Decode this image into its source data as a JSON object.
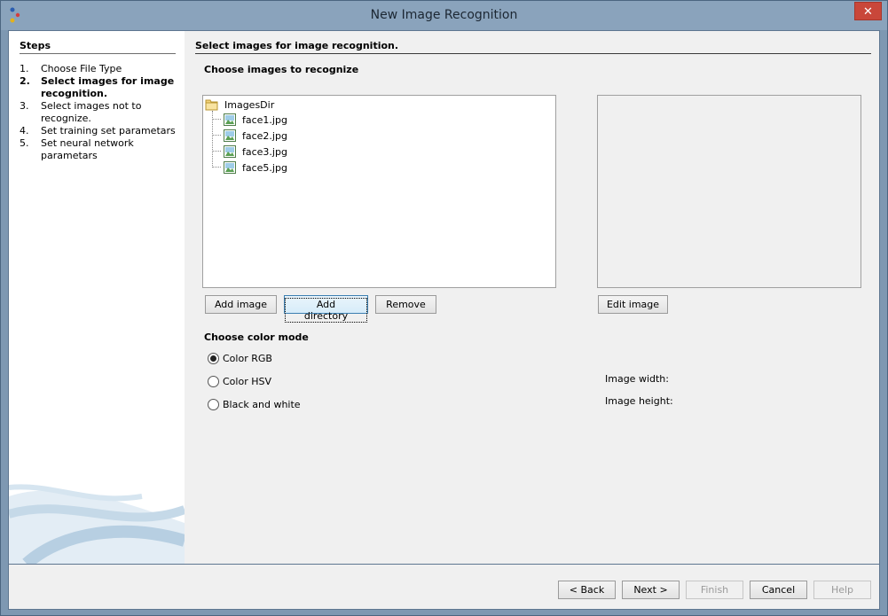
{
  "window": {
    "title": "New Image Recognition",
    "close_glyph": "✕"
  },
  "steps": {
    "title": "Steps",
    "items": [
      {
        "num": "1.",
        "label": "Choose File Type",
        "active": false
      },
      {
        "num": "2.",
        "label": "Select images for image recognition.",
        "active": true
      },
      {
        "num": "3.",
        "label": "Select images not to recognize.",
        "active": false
      },
      {
        "num": "4.",
        "label": "Set training set parametars",
        "active": false
      },
      {
        "num": "5.",
        "label": "Set neural network parametars",
        "active": false
      }
    ]
  },
  "main": {
    "header": "Select images for image recognition.",
    "choose_images_label": "Choose images to recognize",
    "tree": {
      "root": "ImagesDir",
      "files": [
        "face1.jpg",
        "face2.jpg",
        "face3.jpg",
        "face5.jpg"
      ]
    },
    "buttons": {
      "add_image": "Add image",
      "add_directory": "Add directory",
      "remove": "Remove",
      "edit_image": "Edit image"
    },
    "color_mode": {
      "label": "Choose color mode",
      "options": [
        {
          "label": "Color RGB",
          "checked": true
        },
        {
          "label": "Color HSV",
          "checked": false
        },
        {
          "label": "Black and white",
          "checked": false
        }
      ]
    },
    "image_width_label": "Image width:",
    "image_height_label": "Image height:"
  },
  "footer": {
    "back": {
      "label": "< Back",
      "enabled": true
    },
    "next": {
      "label": "Next >",
      "enabled": true
    },
    "finish": {
      "label": "Finish",
      "enabled": false
    },
    "cancel": {
      "label": "Cancel",
      "enabled": true
    },
    "help": {
      "label": "Help",
      "enabled": false
    }
  },
  "colors": {
    "title_bar": "#8aa3bc",
    "close_button": "#c9473a",
    "panel_bg": "#f0f0f0",
    "steps_bg": "#ffffff"
  },
  "icons": {
    "app": "app-icon",
    "folder": "folder-icon",
    "image_file": "image-file-icon",
    "close": "close-icon"
  }
}
